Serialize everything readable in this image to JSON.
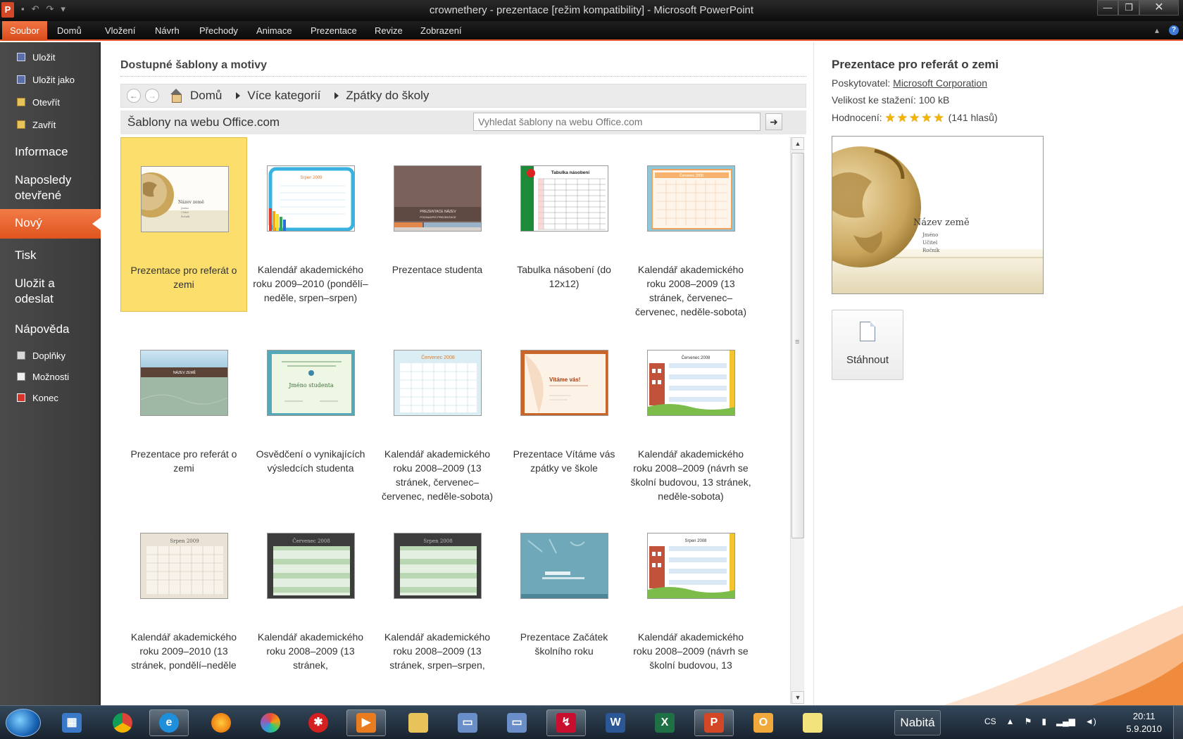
{
  "window": {
    "title": "crownethery - prezentace [režim kompatibility]  -  Microsoft PowerPoint",
    "app_icon_letter": "P",
    "controls": {
      "minimize": "—",
      "maximize": "❐",
      "close": "✕"
    }
  },
  "ribbon": {
    "file_tab": "Soubor",
    "tabs": [
      "Domů",
      "Vložení",
      "Návrh",
      "Přechody",
      "Animace",
      "Prezentace",
      "Revize",
      "Zobrazení"
    ],
    "help": "?"
  },
  "backstage_nav": {
    "top_items": [
      {
        "label": "Uložit",
        "icon": "save-icon"
      },
      {
        "label": "Uložit jako",
        "icon": "save-as-icon"
      },
      {
        "label": "Otevřít",
        "icon": "open-folder-icon"
      },
      {
        "label": "Zavřít",
        "icon": "close-folder-icon"
      }
    ],
    "info": "Informace",
    "recent_line1": "Naposledy",
    "recent_line2": "otevřené",
    "new": "Nový",
    "print": "Tisk",
    "send_line1": "Uložit a",
    "send_line2": "odeslat",
    "help": "Nápověda",
    "bottom_items": [
      {
        "label": "Doplňky",
        "icon": "addins-icon"
      },
      {
        "label": "Možnosti",
        "icon": "options-icon"
      },
      {
        "label": "Konec",
        "icon": "exit-icon"
      }
    ]
  },
  "templates": {
    "section_title": "Dostupné šablony a motivy",
    "breadcrumb": [
      "Domů",
      "Více kategorií",
      "Zpátky do školy"
    ],
    "site_label": "Šablony na webu Office.com",
    "search_placeholder": "Vyhledat šablony na webu Office.com",
    "items": [
      {
        "label": "Prezentace pro referát o zemi",
        "selected": true,
        "thumb": "globe"
      },
      {
        "label": "Kalendář akademického roku 2009–2010 (pondělí–neděle, srpen–srpen)",
        "selected": false,
        "thumb": "cal-pencils"
      },
      {
        "label": "Prezentace studenta",
        "selected": false,
        "thumb": "brown-title"
      },
      {
        "label": "Tabulka násobení (do 12x12)",
        "selected": false,
        "thumb": "times-table"
      },
      {
        "label": "Kalendář akademického roku 2008–2009 (13 stránek, červenec–červenec, neděle-sobota)",
        "selected": false,
        "thumb": "cal-orange"
      },
      {
        "label": "Prezentace pro referát o zemi",
        "selected": false,
        "thumb": "green-sky"
      },
      {
        "label": "Osvědčení o vynikajících výsledcích studenta",
        "selected": false,
        "thumb": "certificate"
      },
      {
        "label": "Kalendář akademického roku 2008–2009 (13 stránek, červenec–červenec, neděle-sobota)",
        "selected": false,
        "thumb": "cal-blue"
      },
      {
        "label": "Prezentace Vítáme vás zpátky ve škole",
        "selected": false,
        "thumb": "welcome"
      },
      {
        "label": "Kalendář akademického roku 2008–2009 (návrh se školní budovou, 13 stránek, neděle-sobota)",
        "selected": false,
        "thumb": "cal-school"
      },
      {
        "label": "Kalendář akademického roku 2009–2010 (13 stránek, pondělí–neděle",
        "selected": false,
        "thumb": "cal-beige"
      },
      {
        "label": "Kalendář akademického roku 2008–2009 (13 stránek,",
        "selected": false,
        "thumb": "cal-dark-green"
      },
      {
        "label": "Kalendář akademického roku 2008–2009 (13 stránek, srpen–srpen,",
        "selected": false,
        "thumb": "cal-dark-green-2"
      },
      {
        "label": "Prezentace Začátek školního roku",
        "selected": false,
        "thumb": "chalkboard"
      },
      {
        "label": "Kalendář akademického roku 2008–2009 (návrh se školní budovou, 13",
        "selected": false,
        "thumb": "cal-school-2"
      }
    ],
    "thumb_titles": {
      "globe_name": "Název země",
      "globe_lines": [
        "Jméno",
        "Učitel",
        "Ročník"
      ],
      "cal_srpen_2009": "Srpen 2009",
      "brown_title": "PREZENTACE NÁZEV",
      "brown_sub": "PODNADPIS PREZENTACE",
      "times_table": "Tabulka násobení",
      "cal_cervenec_2008": "Červenec 2008",
      "green_sky": "NÁZEV ZEMĚ",
      "certificate": "Jméno studenta",
      "welcome": "Vítáme vás!",
      "cal_srpen_2008": "Srpen 2008"
    }
  },
  "details": {
    "title": "Prezentace pro referát o zemi",
    "provider_label": "Poskytovatel:",
    "provider": "Microsoft Corporation",
    "size": "Velikost ke stažení: 100 kB",
    "rating_label": "Hodnocení:",
    "rating_stars": "★★★★★",
    "rating_value": 5,
    "rating_count": "(141 hlasů)",
    "download_label": "Stáhnout"
  },
  "taskbar": {
    "apps": [
      "windows-explorer",
      "chrome",
      "internet-explorer",
      "firefox",
      "picasa",
      "app-red",
      "media-player",
      "folder",
      "scanner",
      "scanner-2",
      "app-red-2",
      "word",
      "excel",
      "powerpoint",
      "outlook",
      "notes"
    ],
    "battery_label": "Nabitá",
    "language": "CS",
    "time": "20:11",
    "date": "5.9.2010"
  },
  "colors": {
    "accent_orange": "#e8562a",
    "nav_bg": "#404040",
    "selected_tile": "#fbde6b"
  }
}
